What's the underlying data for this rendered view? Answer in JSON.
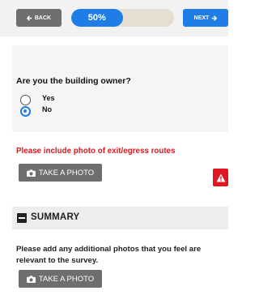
{
  "header": {
    "back_label": "BACK",
    "next_label": "NEXT",
    "progress_text": "50%",
    "progress_value": 0.5
  },
  "question": {
    "text": "Are you the building owner?",
    "options": [
      {
        "label": "Yes",
        "selected": false
      },
      {
        "label": "No",
        "selected": true
      }
    ]
  },
  "photo_section": {
    "warning": "Please include photo of exit/egress routes",
    "button_label": "TAKE A PHOTO"
  },
  "summary": {
    "title": "SUMMARY",
    "text": "Please add any additional photos that you feel are relevant to the survey.",
    "button_label": "TAKE A PHOTO"
  },
  "colors": {
    "primary": "#1f7ee6",
    "button_gray": "#6e6e6e",
    "error": "#e4141b"
  }
}
